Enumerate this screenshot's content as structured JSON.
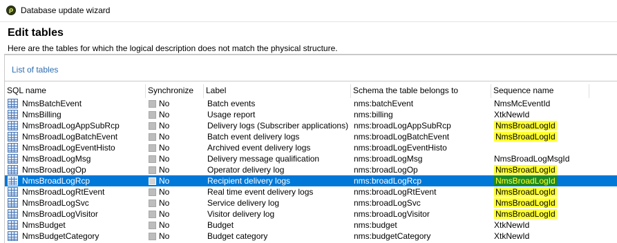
{
  "window": {
    "title": "Database update wizard"
  },
  "header": {
    "title": "Edit tables",
    "subtitle": "Here are the tables for which the logical description does not match the physical structure."
  },
  "section": {
    "title": "List of tables"
  },
  "table": {
    "columns": [
      "SQL name",
      "Synchronize",
      "Label",
      "Schema the table belongs to",
      "Sequence name"
    ],
    "rows": [
      {
        "sql": "NmsBatchEvent",
        "sync": "No",
        "label": "Batch events",
        "schema": "nms:batchEvent",
        "seq": "NmsMcEventId",
        "hl": false,
        "selected": false
      },
      {
        "sql": "NmsBilling",
        "sync": "No",
        "label": "Usage report",
        "schema": "nms:billing",
        "seq": "XtkNewId",
        "hl": false,
        "selected": false
      },
      {
        "sql": "NmsBroadLogAppSubRcp",
        "sync": "No",
        "label": "Delivery logs (Subscriber applications)",
        "schema": "nms:broadLogAppSubRcp",
        "seq": "NmsBroadLogId",
        "hl": true,
        "selected": false
      },
      {
        "sql": "NmsBroadLogBatchEvent",
        "sync": "No",
        "label": "Batch event delivery logs",
        "schema": "nms:broadLogBatchEvent",
        "seq": "NmsBroadLogId",
        "hl": true,
        "selected": false
      },
      {
        "sql": "NmsBroadLogEventHisto",
        "sync": "No",
        "label": "Archived event delivery logs",
        "schema": "nms:broadLogEventHisto",
        "seq": "",
        "hl": false,
        "selected": false
      },
      {
        "sql": "NmsBroadLogMsg",
        "sync": "No",
        "label": "Delivery message qualification",
        "schema": "nms:broadLogMsg",
        "seq": "NmsBroadLogMsgId",
        "hl": false,
        "selected": false
      },
      {
        "sql": "NmsBroadLogOp",
        "sync": "No",
        "label": "Operator delivery log",
        "schema": "nms:broadLogOp",
        "seq": "NmsBroadLogId",
        "hl": true,
        "selected": false
      },
      {
        "sql": "NmsBroadLogRcp",
        "sync": "No",
        "label": "Recipient delivery logs",
        "schema": "nms:broadLogRcp",
        "seq": "NmsBroadLogId",
        "hl": true,
        "selected": true
      },
      {
        "sql": "NmsBroadLogRtEvent",
        "sync": "No",
        "label": "Real time event delivery logs",
        "schema": "nms:broadLogRtEvent",
        "seq": "NmsBroadLogId",
        "hl": true,
        "selected": false
      },
      {
        "sql": "NmsBroadLogSvc",
        "sync": "No",
        "label": "Service delivery log",
        "schema": "nms:broadLogSvc",
        "seq": "NmsBroadLogId",
        "hl": true,
        "selected": false
      },
      {
        "sql": "NmsBroadLogVisitor",
        "sync": "No",
        "label": "Visitor delivery log",
        "schema": "nms:broadLogVisitor",
        "seq": "NmsBroadLogId",
        "hl": true,
        "selected": false
      },
      {
        "sql": "NmsBudget",
        "sync": "No",
        "label": "Budget",
        "schema": "nms:budget",
        "seq": "XtkNewId",
        "hl": false,
        "selected": false
      },
      {
        "sql": "NmsBudgetCategory",
        "sync": "No",
        "label": "Budget category",
        "schema": "nms:budgetCategory",
        "seq": "XtkNewId",
        "hl": false,
        "selected": false
      }
    ]
  },
  "colors": {
    "selection": "#0078d7",
    "sequence_highlight": "#ffff30",
    "selected_sequence_highlight": "#1e8a1e",
    "link": "#2b6cb0"
  }
}
